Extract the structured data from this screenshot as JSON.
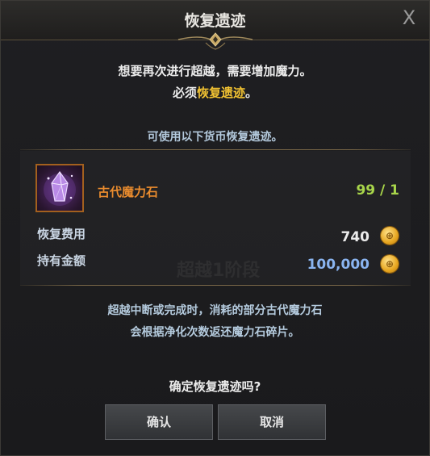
{
  "dialog": {
    "title": "恢复遗迹",
    "close_label": "X",
    "message_line1": "想要再次进行超越，需要增加魔力。",
    "message_line2_prefix": "必须",
    "message_line2_highlight": "恢复遗迹",
    "message_line2_suffix": "。",
    "currency_hint": "可使用以下货币恢复遗迹。",
    "watermark": "超越1阶段",
    "item": {
      "icon": "purple-crystal-icon",
      "name": "古代魔力石",
      "count": "99 / 1"
    },
    "cost": {
      "label": "恢复费用",
      "value": "740",
      "icon": "gold-coin-icon"
    },
    "owned": {
      "label": "持有金额",
      "value": "100,000",
      "icon": "gold-coin-icon"
    },
    "note_line1": "超越中断或完成时，消耗的部分古代魔力石",
    "note_line2": "会根据净化次数返还魔力石碎片。",
    "confirm_question": "确定恢复遗迹吗?",
    "confirm_button": "确认",
    "cancel_button": "取消"
  },
  "colors": {
    "highlight": "#f1c232",
    "item_name": "#ea8c2e",
    "item_count": "#a8d54a",
    "cost_value": "#ececec",
    "owned_value": "#8ab4f0",
    "info_text": "#b4cadd"
  }
}
